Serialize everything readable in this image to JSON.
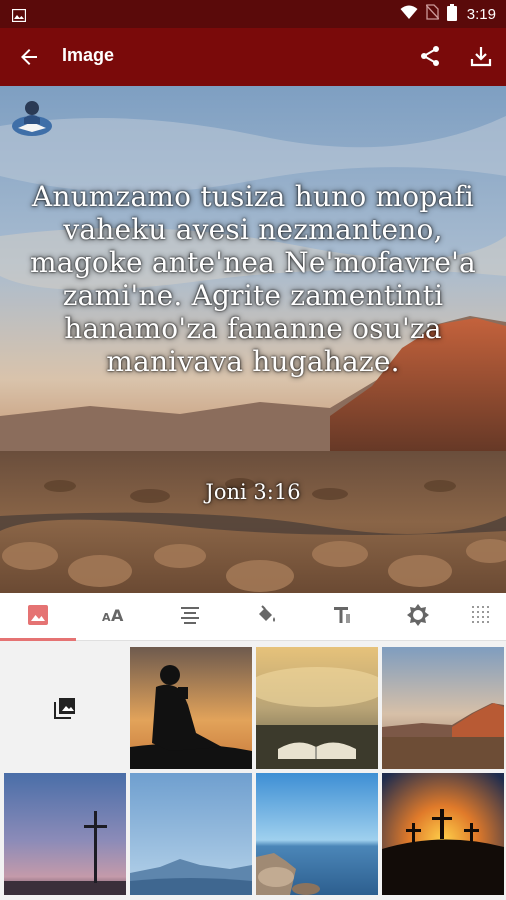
{
  "status_bar": {
    "time": "3:19",
    "icons": [
      "image-icon",
      "wifi-icon",
      "no-sim-icon",
      "battery-icon"
    ]
  },
  "app_bar": {
    "title": "Image",
    "back_icon": "arrow-back-icon",
    "actions": [
      "share-icon",
      "download-icon"
    ],
    "color": "#7a0a0a"
  },
  "preview": {
    "verse_text": "Anumzamo tusiza huno mopafi vaheku avesi nezmanteno, magoke ante'nea Ne'mofavre'a zami'ne. Agrite zamentinti hanamo'za fananne osu'za manivava hugahaze.",
    "reference": "Joni 3:16",
    "background": "desert-mountain-sunset"
  },
  "tabs": {
    "items": [
      {
        "name": "background-image",
        "icon": "image-icon",
        "selected": true
      },
      {
        "name": "font-size",
        "icon": "text-size-icon",
        "selected": false
      },
      {
        "name": "alignment",
        "icon": "align-center-icon",
        "selected": false
      },
      {
        "name": "color",
        "icon": "paint-bucket-icon",
        "selected": false
      },
      {
        "name": "font",
        "icon": "text-format-icon",
        "selected": false
      },
      {
        "name": "brightness",
        "icon": "brightness-icon",
        "selected": false
      },
      {
        "name": "texture",
        "icon": "texture-grid-icon",
        "selected": false
      }
    ],
    "accent": "#e57373"
  },
  "backgrounds": [
    {
      "name": "gallery-picker",
      "icon": "photo-library-icon"
    },
    {
      "name": "child-reading-silhouette"
    },
    {
      "name": "open-bible-lake"
    },
    {
      "name": "desert-mountain-sunset"
    },
    {
      "name": "cross-at-dusk"
    },
    {
      "name": "blue-mountains"
    },
    {
      "name": "rocky-lake-shore"
    },
    {
      "name": "three-crosses-sunset"
    }
  ]
}
